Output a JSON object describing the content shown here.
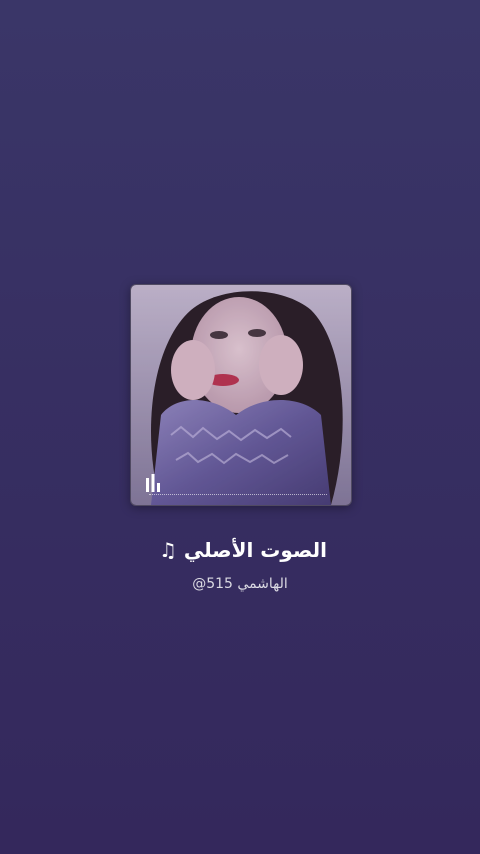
{
  "sound": {
    "title": "الصوت الأصلي",
    "note_icon": "♫",
    "author": "@الهاشمي 515"
  },
  "cover": {
    "image": "portrait-photo",
    "overlay_icon": "equalizer-icon"
  },
  "colors": {
    "background_top": "#3a3668",
    "background_bottom": "#34285c",
    "text": "#ffffff"
  }
}
